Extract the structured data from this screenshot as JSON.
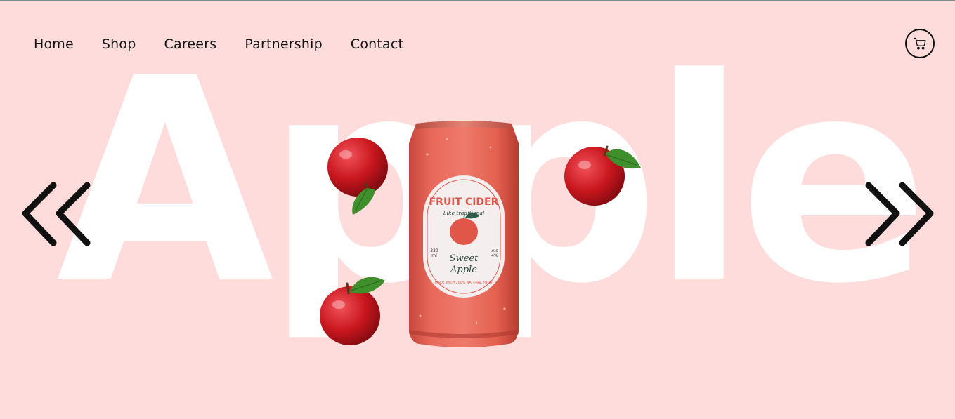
{
  "nav": {
    "items": [
      {
        "label": "Home"
      },
      {
        "label": "Shop"
      },
      {
        "label": "Careers"
      },
      {
        "label": "Partnership"
      },
      {
        "label": "Contact"
      }
    ]
  },
  "hero": {
    "big_word": "Apple"
  },
  "product": {
    "brand": "FRUIT CIDER",
    "tagline": "Like traditional",
    "flavor_line1": "Sweet",
    "flavor_line2": "Apple",
    "volume": "330",
    "volume_unit": "ml",
    "alc_label": "Alc",
    "alc_value": "4%",
    "bottom_text": "MADE WITH 100% NATURAL FRUIT"
  },
  "icons": {
    "cart": "cart-icon",
    "prev": "chevron-double-left-icon",
    "next": "chevron-double-right-icon"
  },
  "colors": {
    "background": "#fedcdc",
    "can": "#e8685a",
    "label": "#f4eeee",
    "apple_red": "#c8161d",
    "leaf": "#3f8f2c"
  }
}
